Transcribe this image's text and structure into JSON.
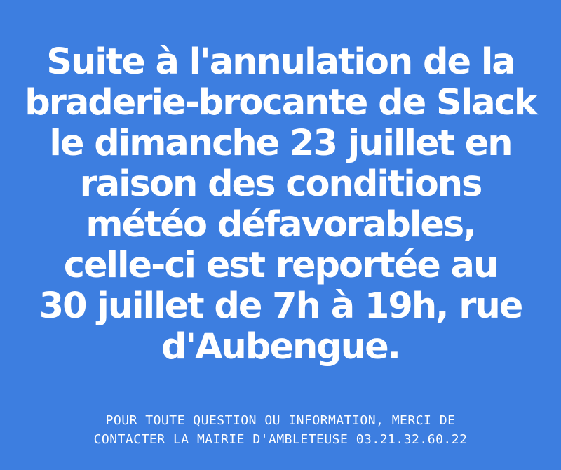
{
  "announcement": {
    "lines": [
      "Suite à l'annulation de la",
      "braderie-brocante de Slack",
      "le dimanche 23 juillet en",
      "raison des conditions",
      "météo défavorables,",
      "celle-ci est reportée au",
      "30 juillet de 7h à 19h, rue",
      "d'Aubengue."
    ]
  },
  "footer": {
    "lines": [
      "POUR TOUTE QUESTION OU INFORMATION, MERCI DE",
      "CONTACTER LA MAIRIE D'AMBLETEUSE 03.21.32.60.22"
    ]
  },
  "colors": {
    "background": "#3d7ee0",
    "text": "#ffffff"
  }
}
